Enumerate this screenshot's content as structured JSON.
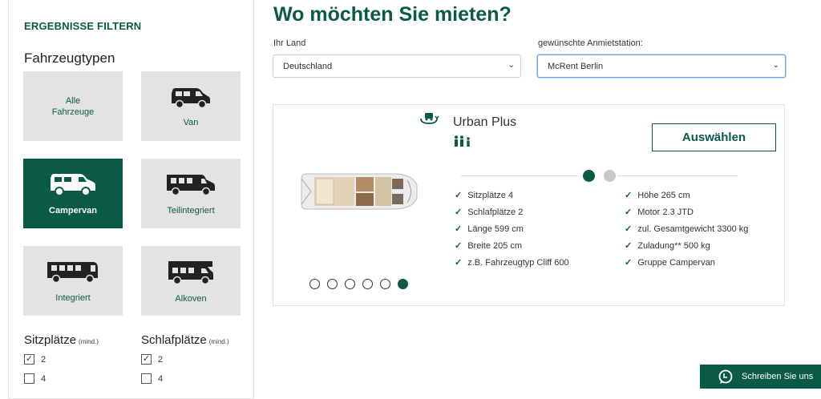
{
  "sidebar": {
    "title": "ERGEBNISSE FILTERN",
    "section_title": "Fahrzeugtypen",
    "vehicle_types": [
      {
        "label_line1": "Alle",
        "label_line2": "Fahrzeuge",
        "icon": "all-vehicles",
        "active": false
      },
      {
        "label": "Van",
        "icon": "van-icon",
        "active": false
      },
      {
        "label": "Campervan",
        "icon": "campervan-icon",
        "active": true
      },
      {
        "label": "Teilintegriert",
        "icon": "teilintegriert-icon",
        "active": false
      },
      {
        "label": "Integriert",
        "icon": "integriert-icon",
        "active": false
      },
      {
        "label": "Alkoven",
        "icon": "alkoven-icon",
        "active": false
      }
    ],
    "seats": {
      "title": "Sitzplätze",
      "hint": "(mind.)",
      "options": [
        {
          "label": "2",
          "checked": true
        },
        {
          "label": "4",
          "checked": false
        }
      ]
    },
    "beds": {
      "title": "Schlafplätze",
      "hint": "(mind.)",
      "options": [
        {
          "label": "2",
          "checked": true
        },
        {
          "label": "4",
          "checked": false
        }
      ]
    }
  },
  "main": {
    "title": "Wo möchten Sie mieten?",
    "country": {
      "label": "Ihr Land",
      "value": "Deutschland"
    },
    "station": {
      "label": "gewünschte Anmietstation:",
      "value": "McRent Berlin"
    }
  },
  "vehicle": {
    "name": "Urban Plus",
    "select_button": "Auswählen",
    "specs_left": [
      "Sitzplätze 4",
      "Schlafplätze 2",
      "Länge 599 cm",
      "Breite 205 cm",
      "z.B. Fahrzeugtyp Cliff 600"
    ],
    "specs_right": [
      "Höhe 265 cm",
      "Motor 2.3 JTD",
      "zul. Gesamtgewicht 3300 kg",
      "Zuladung** 500 kg",
      "Gruppe Campervan"
    ],
    "spec_pages": 2,
    "spec_page_active": 1,
    "image_count": 6,
    "image_active": 6
  },
  "chat": {
    "label": "Schreiben Sie uns"
  },
  "colors": {
    "brand": "#0b5a46",
    "tile_bg": "#e3e3e3",
    "inactive_dot": "#c8c8c8"
  }
}
